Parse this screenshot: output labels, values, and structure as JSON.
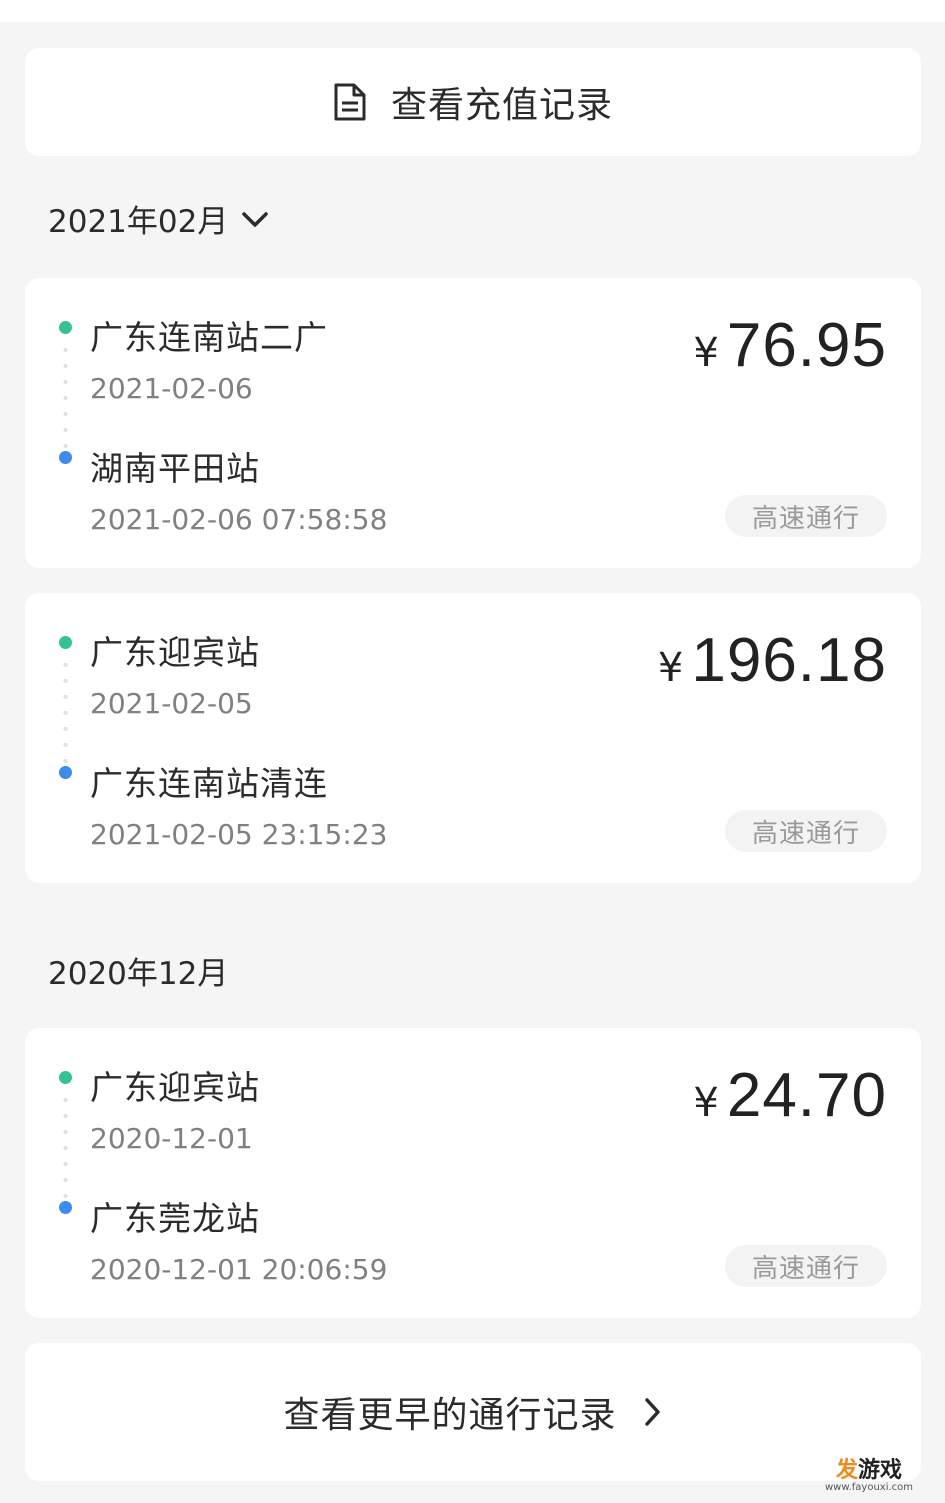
{
  "recharge": {
    "label": "查看充值记录",
    "icon": "document-icon"
  },
  "months": [
    {
      "label": "2021年02月",
      "has_chevron": true,
      "trips": [
        {
          "from_station": "广东连南站二广",
          "from_date": "2021-02-06",
          "to_station": "湖南平田站",
          "to_datetime": "2021-02-06 07:58:58",
          "currency": "¥",
          "amount": "76.95",
          "tag": "高速通行"
        },
        {
          "from_station": "广东迎宾站",
          "from_date": "2021-02-05",
          "to_station": "广东连南站清连",
          "to_datetime": "2021-02-05 23:15:23",
          "currency": "¥",
          "amount": "196.18",
          "tag": "高速通行"
        }
      ]
    },
    {
      "label": "2020年12月",
      "has_chevron": false,
      "trips": [
        {
          "from_station": "广东迎宾站",
          "from_date": "2020-12-01",
          "to_station": "广东莞龙站",
          "to_datetime": "2020-12-01 20:06:59",
          "currency": "¥",
          "amount": "24.70",
          "tag": "高速通行"
        }
      ]
    }
  ],
  "more": {
    "label": "查看更早的通行记录"
  },
  "watermark": {
    "brand_a": "发",
    "brand_b": "游戏",
    "url": "www.fayouxi.com"
  },
  "colors": {
    "origin_dot": "#34c38f",
    "destination_dot": "#3d8bea",
    "background": "#f5f5f5"
  }
}
